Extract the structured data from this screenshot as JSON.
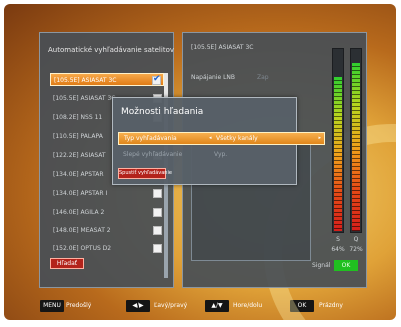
{
  "left_panel": {
    "title": "Automatické vyhľadávanie satelitov",
    "satellites": [
      {
        "label": "[105.5E] ASIASAT 3C",
        "checked": true,
        "selected": true
      },
      {
        "label": "[105.5E] ASIASAT 3C",
        "checked": false,
        "selected": false
      },
      {
        "label": "[108.2E] NSS 11",
        "checked": false,
        "selected": false
      },
      {
        "label": "[110.5E] PALAPA",
        "checked": false,
        "selected": false
      },
      {
        "label": "[122.2E] ASIASAT",
        "checked": false,
        "selected": false
      },
      {
        "label": "[134.0E] APSTAR",
        "checked": false,
        "selected": false
      },
      {
        "label": "[134.0E] APSTAR I",
        "checked": false,
        "selected": false
      },
      {
        "label": "[146.0E] AGILA 2",
        "checked": false,
        "selected": false
      },
      {
        "label": "[148.0E] MEASAT 2",
        "checked": false,
        "selected": false
      },
      {
        "label": "[152.0E] OPTUS D2",
        "checked": false,
        "selected": false
      }
    ],
    "search_button": "Hľadať"
  },
  "right_panel": {
    "satellite": "[105.5E] ASIASAT 3C",
    "lnb_label": "Napájanie LNB",
    "lnb_value": "Zap",
    "signal": {
      "s_label": "S",
      "q_label": "Q",
      "s_value": "64%",
      "q_value": "72%",
      "s_level": 0.64,
      "q_level": 0.72,
      "signal_label": "Signál",
      "status": "OK"
    }
  },
  "dialog": {
    "title": "Možnosti hľadania",
    "row1_label": "Typ vyhľadávania",
    "row1_value": "Všetky kanály",
    "row2_label": "Slepé vyhľadávanie",
    "row2_value": "Vyp.",
    "start_button": "Spustiť vyhľadávanie"
  },
  "footer": {
    "menu_key": "MENU",
    "menu_label": "Predošlý",
    "lr_key": "◀/▶",
    "lr_label": "Ľavý/pravý",
    "ud_key": "▲/▼",
    "ud_label": "Hore/dolu",
    "ok_key": "OK",
    "ok_label": "Prázdny"
  },
  "colors": {
    "highlight": "#e8901f",
    "button_red": "#b3231b",
    "ok_green": "#20c020",
    "panel": "#464e56"
  }
}
